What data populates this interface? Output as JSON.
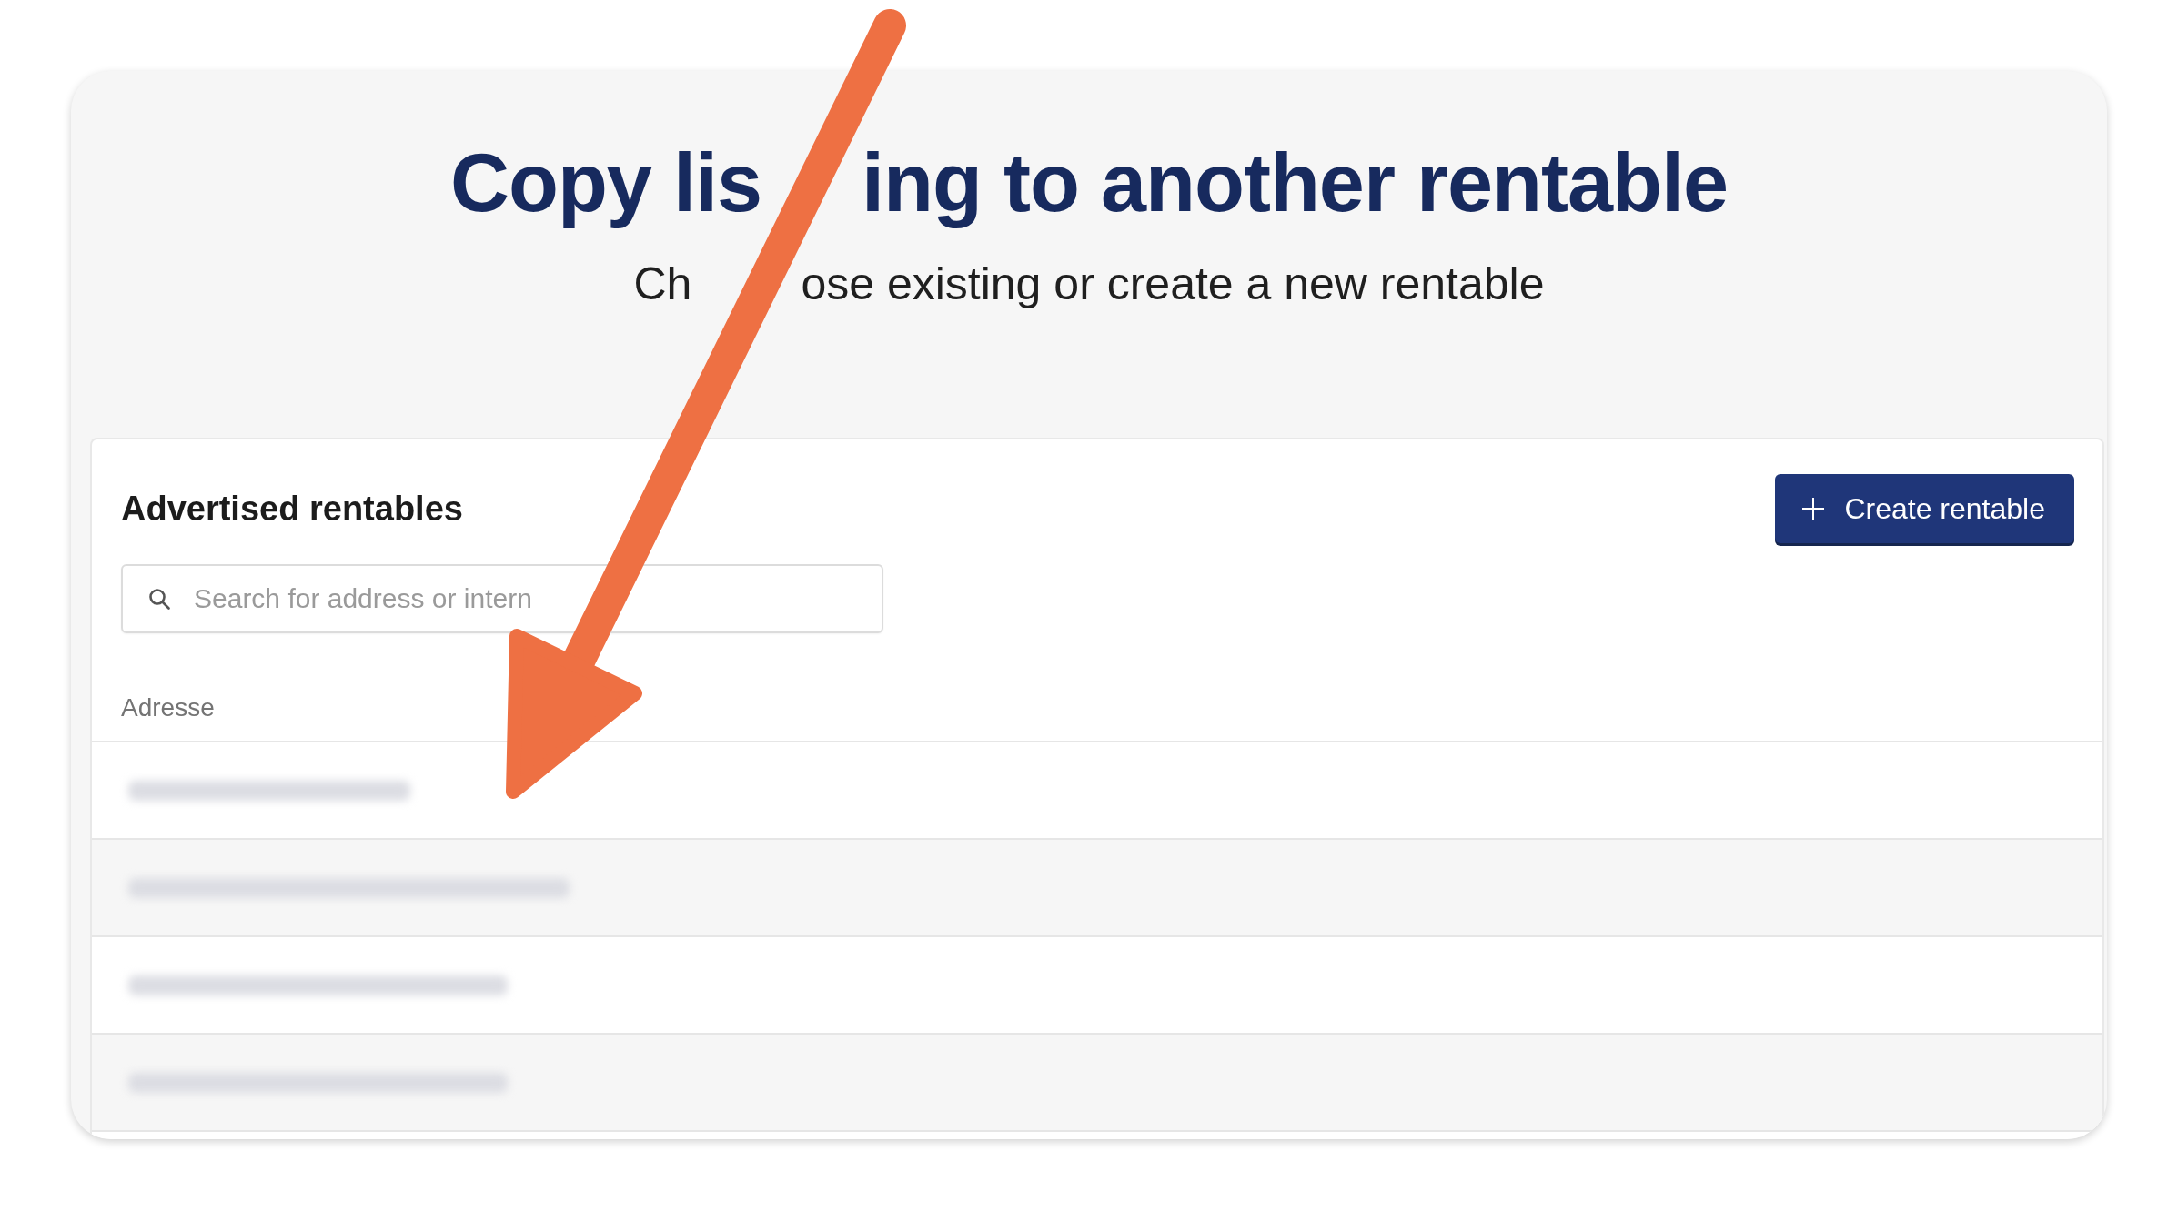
{
  "dialog": {
    "title_parts": [
      "Copy lis",
      "ing to another rentable"
    ],
    "subtitle_parts": [
      "Ch",
      "ose existing or create a new rentable"
    ]
  },
  "panel": {
    "heading": "Advertised rentables",
    "create_button": {
      "label": "Create rentable"
    },
    "search": {
      "placeholder": "Search for address or intern"
    }
  },
  "table": {
    "columns": [
      "Adresse"
    ],
    "rows": [
      {
        "kind": "blurred"
      },
      {
        "kind": "blurred"
      },
      {
        "kind": "blurred"
      },
      {
        "kind": "blurred"
      }
    ]
  },
  "annotation": {
    "kind": "arrow"
  }
}
